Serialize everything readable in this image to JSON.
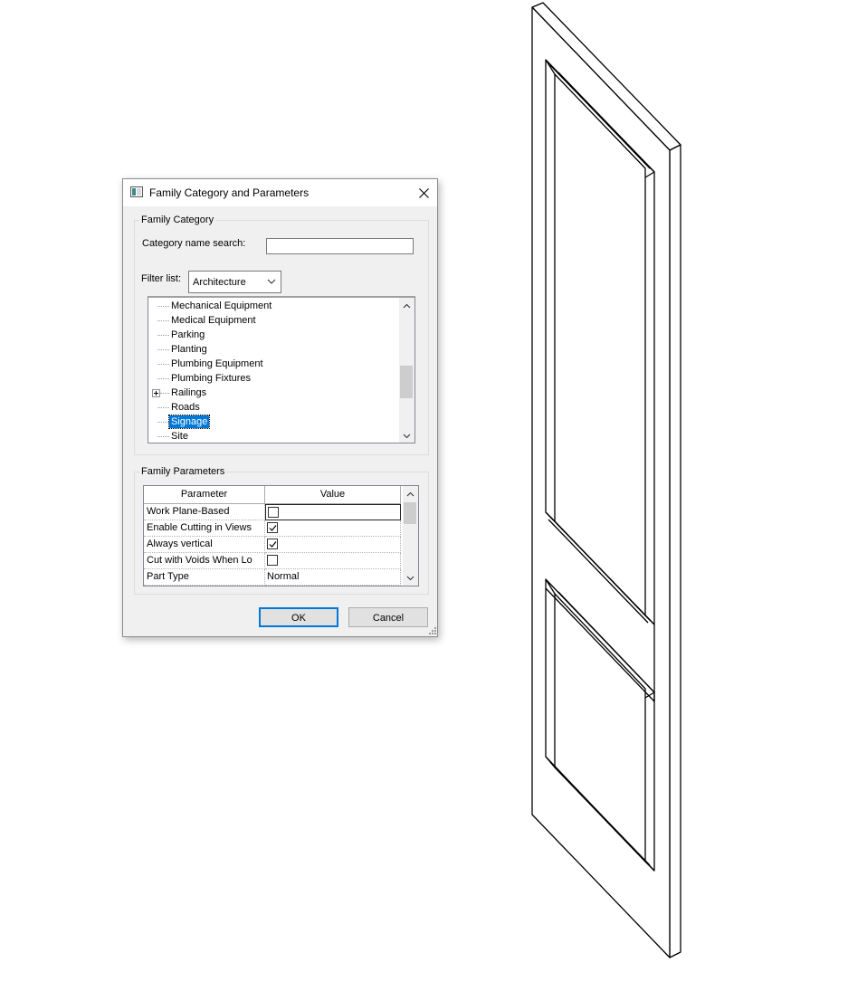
{
  "dialog": {
    "title": "Family Category and Parameters",
    "family_category_group": "Family Category",
    "category_search_label": "Category name search:",
    "category_search_value": "",
    "filter_label": "Filter list:",
    "filter_value": "Architecture",
    "tree_items": [
      {
        "label": "Mechanical Equipment",
        "expandable": false,
        "selected": false
      },
      {
        "label": "Medical Equipment",
        "expandable": false,
        "selected": false
      },
      {
        "label": "Parking",
        "expandable": false,
        "selected": false
      },
      {
        "label": "Planting",
        "expandable": false,
        "selected": false
      },
      {
        "label": "Plumbing Equipment",
        "expandable": false,
        "selected": false
      },
      {
        "label": "Plumbing Fixtures",
        "expandable": false,
        "selected": false
      },
      {
        "label": "Railings",
        "expandable": true,
        "selected": false
      },
      {
        "label": "Roads",
        "expandable": false,
        "selected": false
      },
      {
        "label": "Signage",
        "expandable": false,
        "selected": true
      },
      {
        "label": "Site",
        "expandable": false,
        "selected": false
      }
    ],
    "family_parameters_group": "Family Parameters",
    "grid_headers": {
      "parameter": "Parameter",
      "value": "Value"
    },
    "parameters": [
      {
        "name": "Work Plane-Based",
        "type": "checkbox",
        "checked": false,
        "active": true
      },
      {
        "name": "Enable Cutting in Views",
        "type": "checkbox",
        "checked": true,
        "active": false
      },
      {
        "name": "Always vertical",
        "type": "checkbox",
        "checked": true,
        "active": false
      },
      {
        "name": "Cut with Voids When Lo",
        "type": "checkbox",
        "checked": false,
        "active": false
      },
      {
        "name": "Part Type",
        "type": "text",
        "value": "Normal",
        "active": false
      }
    ],
    "ok_label": "OK",
    "cancel_label": "Cancel"
  },
  "colors": {
    "selection": "#0078d7",
    "dialog_bg": "#f0f0f0",
    "default_button_border": "#0078d7"
  },
  "icons": {
    "title_icon": "window-icon",
    "close": "close-icon",
    "dropdown": "chevron-down-icon",
    "scroll_up": "chevron-up-icon",
    "scroll_down": "chevron-down-icon",
    "resize": "resize-grip-icon"
  }
}
